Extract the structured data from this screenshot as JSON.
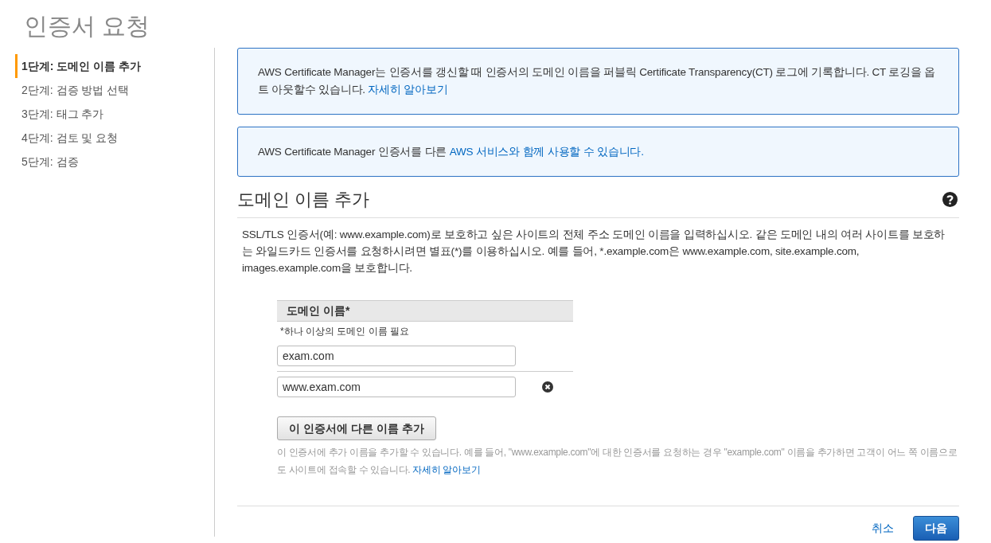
{
  "page_title": "인증서 요청",
  "steps": [
    {
      "label": "1단계: 도메인 이름 추가",
      "selected": true
    },
    {
      "label": "2단계: 검증 방법 선택",
      "selected": false
    },
    {
      "label": "3단계: 태그 추가",
      "selected": false
    },
    {
      "label": "4단계: 검토 및 요청",
      "selected": false
    },
    {
      "label": "5단계: 검증",
      "selected": false
    }
  ],
  "notices": [
    {
      "text": "AWS Certificate Manager는 인증서를 갱신할 때 인증서의 도메인 이름을 퍼블릭 Certificate Transparency(CT) 로그에 기록합니다. CT 로깅을 옵트 아웃할수 있습니다.",
      "link": "자세히 알아보기"
    },
    {
      "text": "AWS Certificate Manager 인증서를 다른",
      "link": "AWS 서비스와 함께 사용할 수 있습니다."
    }
  ],
  "section": {
    "title": "도메인 이름 추가",
    "description": "SSL/TLS 인증서(예: www.example.com)로 보호하고 싶은 사이트의 전체 주소 도메인 이름을 입력하십시오. 같은 도메인 내의 여러 사이트를 보호하는 와일드카드 인증서를 요청하시려면 별표(*)를 이용하십시오. 예를 들어, *.example.com은 www.example.com, site.example.com, images.example.com을 보호합니다."
  },
  "domain_table": {
    "header": "도메인 이름*",
    "hint": "*하나 이상의 도메인 이름 필요",
    "domains": [
      {
        "value": "exam.com",
        "removable": false
      },
      {
        "value": "www.exam.com",
        "removable": true
      }
    ]
  },
  "add_button": "이 인증서에 다른 이름 추가",
  "add_help": {
    "text": "이 인증서에 추가 이름을 추가할 수 있습니다. 예를 들어, \"www.example.com\"에 대한 인증서를 요청하는 경우 \"example.com\" 이름을 추가하면 고객이 어느 쪽 이름으로도 사이트에 접속할 수 있습니다.",
    "link": "자세히 알아보기"
  },
  "footer": {
    "cancel": "취소",
    "next": "다음"
  }
}
